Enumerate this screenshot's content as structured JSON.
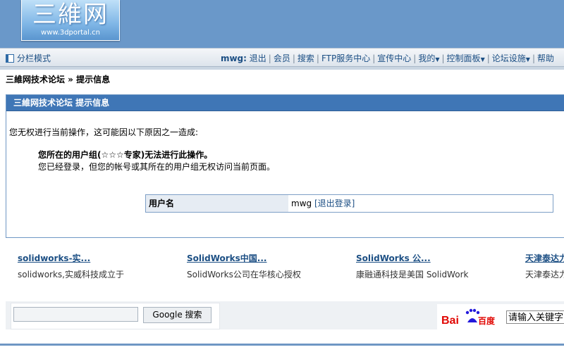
{
  "logo": {
    "text": "三維网",
    "url": "www.3dportal.cn"
  },
  "menubar": {
    "layout_mode": "分栏模式",
    "user": "mwg:",
    "items": [
      "退出",
      "会员",
      "搜索",
      "FTP服务中心",
      "宣传中心",
      "我的",
      "控制面板",
      "论坛设施",
      "帮助"
    ]
  },
  "breadcrumb": "三維网技术论坛 » 提示信息",
  "message": {
    "header": "三維网技术论坛 提示信息",
    "intro": "您无权进行当前操作，这可能因以下原因之一造成:",
    "reason_bold": "您所在的用户组(☆☆☆专家)无法进行此操作。",
    "reason_normal": "您已经登录，但您的帐号或其所在的用户组无权访问当前页面。",
    "login_label": "用户名",
    "login_user": "mwg",
    "logout_link": "[退出登录]"
  },
  "ads": [
    {
      "title": "solidworks-实...",
      "desc": "solidworks,实威科技成立于"
    },
    {
      "title": "SolidWorks中国...",
      "desc": "SolidWorks公司在华核心授权"
    },
    {
      "title": "SolidWorks 公...",
      "desc": "康融通科技是美国  SolidWork"
    },
    {
      "title": "天津泰达力",
      "desc": "天津泰达力"
    }
  ],
  "search": {
    "google_button": "Google 搜索",
    "baidu_placeholder": "请输入关键字",
    "baidu_logo_text": "Bai百度"
  },
  "colors": {
    "header_bg": "#6a98c9",
    "accent": "#3f76b6",
    "link": "#1c4f84"
  }
}
